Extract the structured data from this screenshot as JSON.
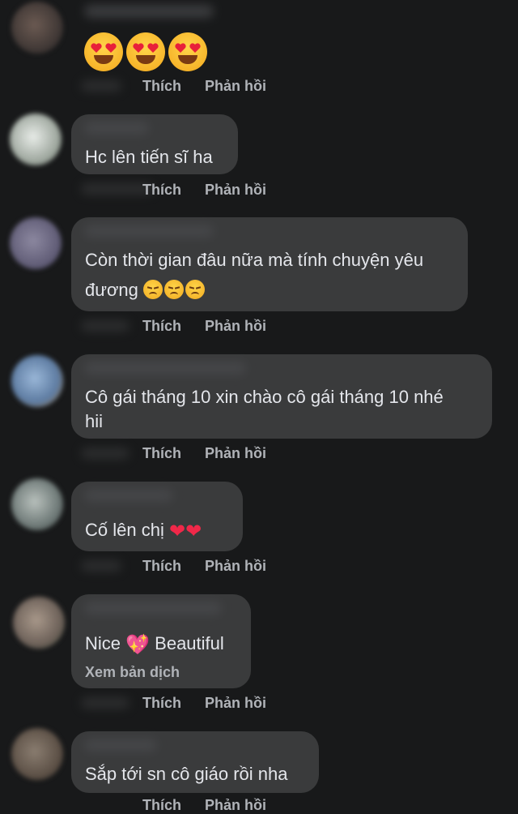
{
  "comments": [
    {
      "text": "",
      "reaction": "heart-eyes-emoji x3",
      "like": "Thích",
      "reply": "Phản hồi"
    },
    {
      "text": "Hc lên tiến sĩ ha",
      "like": "Thích",
      "reply": "Phản hồi"
    },
    {
      "text_line1": "Còn thời gian đâu nữa mà tính chuyện yêu",
      "text_line2": "đương",
      "like": "Thích",
      "reply": "Phản hồi"
    },
    {
      "text_line1": "Cô gái tháng 10 xin chào cô gái tháng 10 nhé",
      "text_line2": "hii",
      "like": "Thích",
      "reply": "Phản hồi"
    },
    {
      "text": "Cố lên chị",
      "like": "Thích",
      "reply": "Phản hồi"
    },
    {
      "text_before": "Nice",
      "text_after": "Beautiful",
      "translate": "Xem bản dịch",
      "like": "Thích",
      "reply": "Phản hồi"
    },
    {
      "text": "Sắp tới sn cô giáo rồi nha",
      "like": "Thích",
      "reply": "Phản hồi"
    }
  ],
  "colors": {
    "background": "#18191a",
    "bubble": "#3a3b3c",
    "text": "#e4e6eb",
    "muted": "#b0b3b8"
  }
}
